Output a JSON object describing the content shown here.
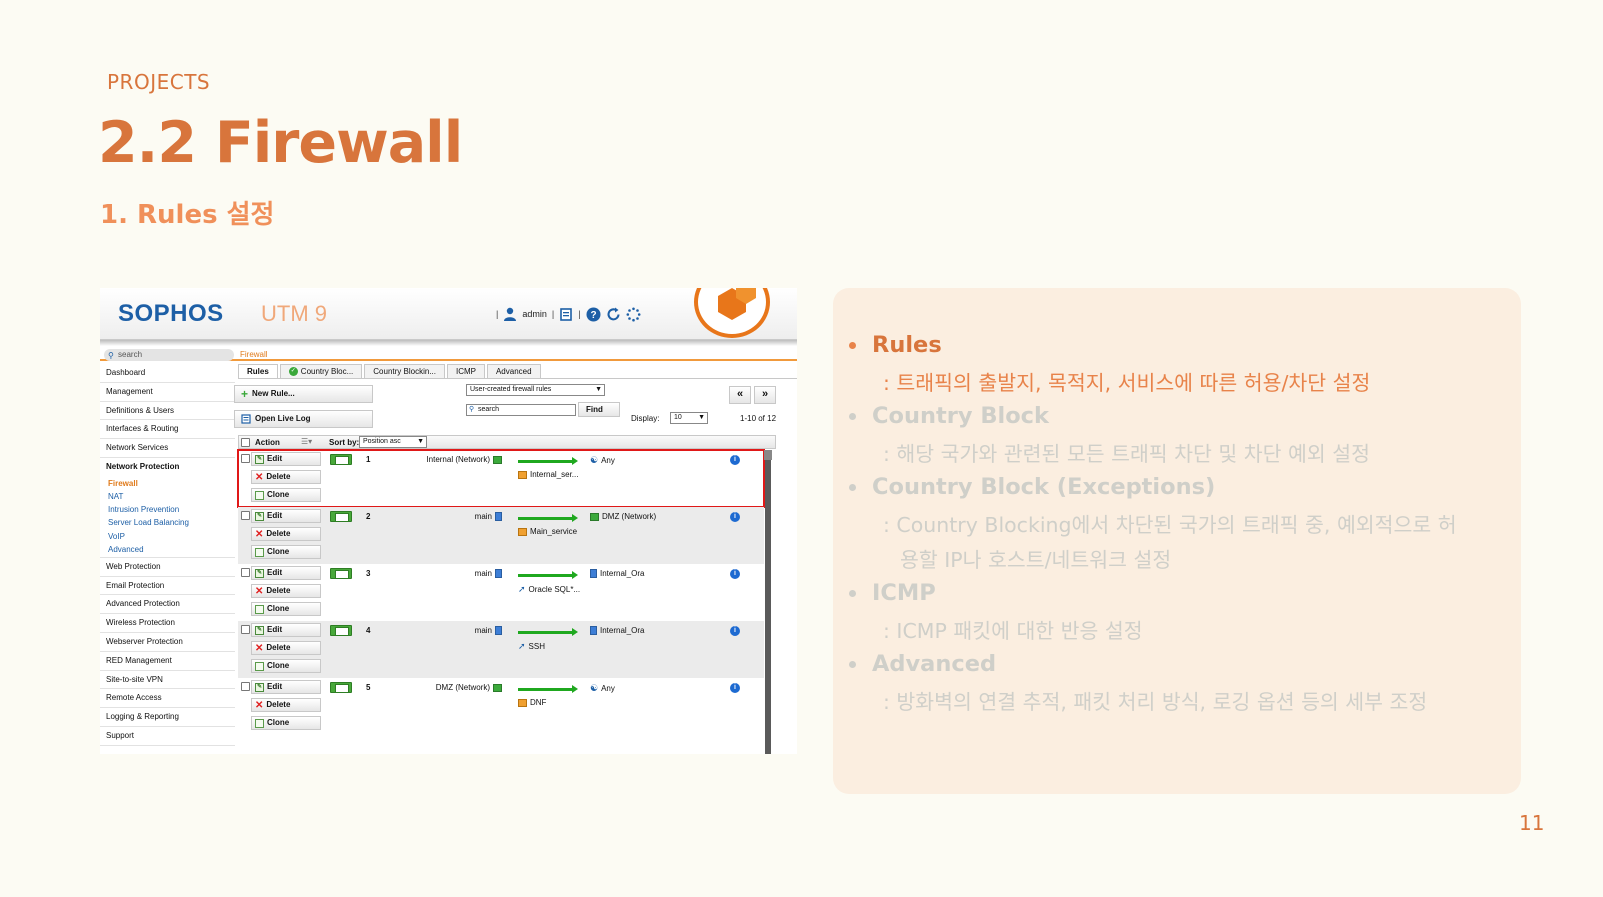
{
  "slide": {
    "section": "PROJECTS",
    "title": "2.2 Firewall",
    "subtitle": "1. Rules 설정",
    "page_number": "11"
  },
  "screenshot": {
    "brand": "SOPHOS",
    "product": "UTM 9",
    "user": "admin",
    "search_placeholder": "search",
    "breadcrumb": "Firewall",
    "nav": [
      "Dashboard",
      "Management",
      "Definitions & Users",
      "Interfaces & Routing",
      "Network Services",
      "Network Protection"
    ],
    "nav_sub": [
      "Firewall",
      "NAT",
      "Intrusion Prevention",
      "Server Load Balancing",
      "VoIP",
      "Advanced"
    ],
    "nav_after": [
      "Web Protection",
      "Email Protection",
      "Advanced Protection",
      "Wireless Protection",
      "Webserver Protection",
      "RED Management",
      "Site-to-site VPN",
      "Remote Access",
      "Logging & Reporting",
      "Support"
    ],
    "tabs": [
      "Rules",
      "Country Bloc...",
      "Country Blockin...",
      "ICMP",
      "Advanced"
    ],
    "new_rule": "New Rule...",
    "open_live_log": "Open Live Log",
    "filter_select": "User-created firewall rules",
    "search_box": "search",
    "find": "Find",
    "display_label": "Display:",
    "display_value": "10",
    "pager_prev": "«",
    "pager_next": "»",
    "range": "1-10 of 12",
    "col_action": "Action",
    "sort_label": "Sort by:",
    "sort_value": "Position asc",
    "btn_edit": "Edit",
    "btn_delete": "Delete",
    "btn_clone": "Clone",
    "rules": [
      {
        "num": "1",
        "source": "Internal (Network)",
        "service": "Internal_ser...",
        "dest": "Any"
      },
      {
        "num": "2",
        "source": "main",
        "service": "Main_service",
        "dest": "DMZ (Network)"
      },
      {
        "num": "3",
        "source": "main",
        "service": "Oracle SQL*...",
        "dest": "Internal_Ora"
      },
      {
        "num": "4",
        "source": "main",
        "service": "SSH",
        "dest": "Internal_Ora"
      },
      {
        "num": "5",
        "source": "DMZ (Network)",
        "service": "DNF",
        "dest": "Any"
      }
    ]
  },
  "bullets": [
    {
      "title": "Rules",
      "desc": ": 트래픽의 출발지, 목적지, 서비스에 따른 허용/차단 설정",
      "active": true
    },
    {
      "title": "Country Block",
      "desc": ": 해당 국가와 관련된 모든 트래픽 차단 및 차단 예외 설정",
      "active": false
    },
    {
      "title": "Country Block (Exceptions)",
      "desc": ":  Country Blocking에서 차단된 국가의 트래픽 중, 예외적으로 허",
      "desc2": "용할 IP나 호스트/네트워크 설정",
      "active": false
    },
    {
      "title": "ICMP",
      "desc": ": ICMP 패킷에 대한 반응 설정",
      "active": false
    },
    {
      "title": "Advanced",
      "desc": ": 방화벽의 연결 추적, 패킷 처리 방식, 로깅 옵션 등의 세부 조정",
      "active": false
    }
  ],
  "colors": {
    "accent": "#d8753c",
    "muted": "#cfcfc9",
    "panel": "#fbeee0",
    "highlight": "#e01818"
  }
}
